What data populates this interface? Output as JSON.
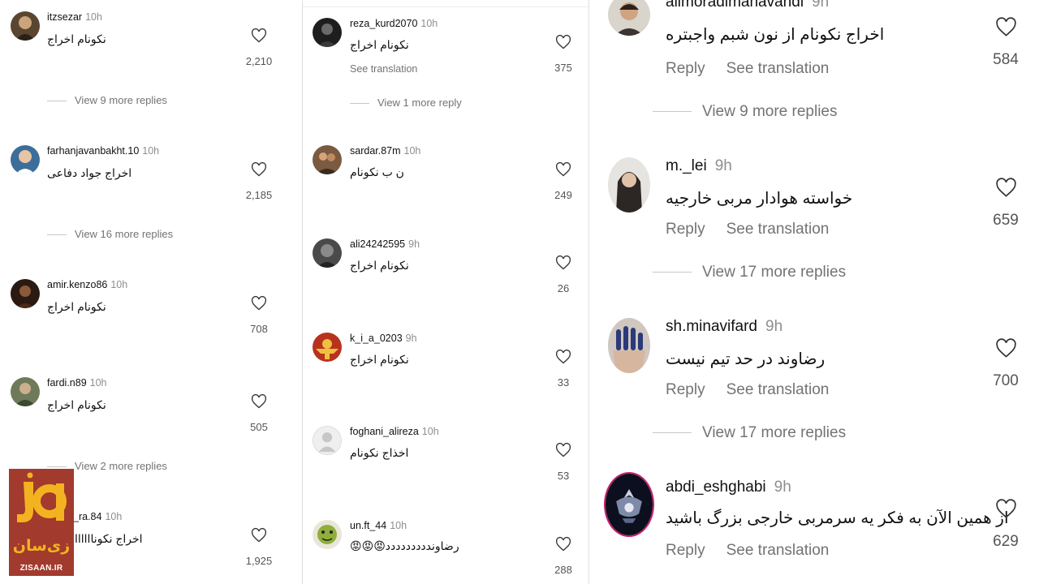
{
  "panel_left": {
    "comments": [
      {
        "username": "itzsezar",
        "time": "10h",
        "text": "نکونام اخراج",
        "likes": "2,210",
        "replies": "View 9 more replies"
      },
      {
        "username": "farhanjavanbakht.10",
        "time": "10h",
        "text": "اخراج جواد دفاعی",
        "likes": "2,185",
        "replies": "View 16 more replies"
      },
      {
        "username": "amir.kenzo86",
        "time": "10h",
        "text": "نکونام اخراج",
        "likes": "708",
        "replies": ""
      },
      {
        "username": "fardi.n89",
        "time": "10h",
        "text": "نکونام اخراج",
        "likes": "505",
        "replies": "View 2 more replies"
      },
      {
        "username": "_ra.84",
        "time": "10h",
        "text": "اخراج نکوناااااا",
        "likes": "1,925",
        "replies": ""
      }
    ]
  },
  "panel_middle": {
    "comments": [
      {
        "username": "reza_kurd2070",
        "time": "10h",
        "text": "نکونام اخراج",
        "see_translation": "See translation",
        "likes": "375",
        "replies": "View 1 more reply"
      },
      {
        "username": "sardar.87m",
        "time": "10h",
        "text": "ن ب نکونام",
        "likes": "249"
      },
      {
        "username": "ali24242595",
        "time": "9h",
        "text": "نکونام اخراج",
        "likes": "26"
      },
      {
        "username": "k_i_a_0203",
        "time": "9h",
        "text": "نکونام اخراج",
        "likes": "33"
      },
      {
        "username": "foghani_alireza",
        "time": "10h",
        "text": "اخذاج نکونام",
        "likes": "53"
      },
      {
        "username": "un.ft_44",
        "time": "10h",
        "text": "رضاونددددددددد😡😡😡",
        "likes": "288"
      }
    ]
  },
  "panel_right": {
    "reply_label": "Reply",
    "see_translation": "See translation",
    "comments": [
      {
        "username": "alimoradimahavandi",
        "time": "9h",
        "text": "اخراج نکونام از نون شبم واجبتره",
        "likes": "584",
        "replies": "View 9 more replies"
      },
      {
        "username": "m._lei",
        "time": "9h",
        "text": "خواسته هوادار مربی خارجیه",
        "likes": "659",
        "replies": "View 17 more replies"
      },
      {
        "username": "sh.minavifard",
        "time": "9h",
        "text": "رضاوند در حد تیم نیست",
        "likes": "700",
        "replies": "View 17 more replies"
      },
      {
        "username": "abdi_eshghabi",
        "time": "9h",
        "text": "از همین الآن به فکر یه سرمربی خارجی بزرگ باشید",
        "likes": "629",
        "replies": ""
      }
    ]
  },
  "watermark": {
    "fa": "زی‌سان",
    "en": "ZISAAN.IR"
  },
  "colors": {
    "background": "#ffffff",
    "muted": "#737373",
    "time": "#8e8e8e",
    "logo_bg": "#a23a2e",
    "logo_accent": "#f3b320"
  }
}
